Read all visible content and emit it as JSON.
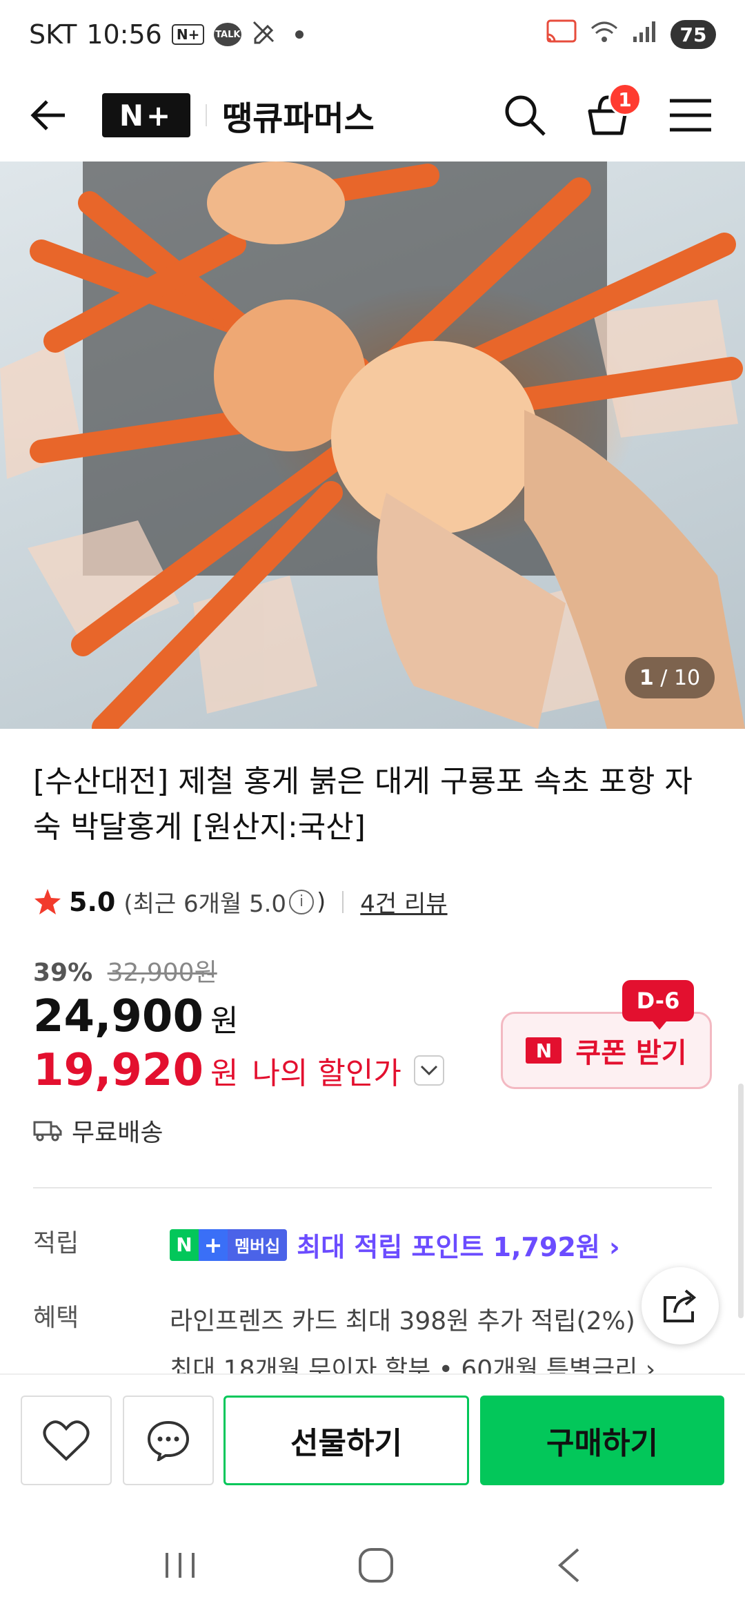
{
  "status_bar": {
    "carrier": "SKT",
    "time": "10:56",
    "np_badge": "N+",
    "talk_badge": "TALK",
    "battery": "75"
  },
  "header": {
    "brand_logo": "N+",
    "store_name": "땡큐파머스",
    "cart_count": "1"
  },
  "gallery": {
    "current": "1",
    "total": "/ 10"
  },
  "product": {
    "title": "[수산대전] 제철 홍게 붉은 대게 구룡포 속초 포항 자숙 박달홍게 [원산지:국산]",
    "rating": "5.0",
    "recent_rating": "(최근 6개월 5.0",
    "recent_close": ")",
    "review_count": "4건 리뷰",
    "discount_rate": "39%",
    "original_price": "32,900원",
    "price": "24,900",
    "price_unit": "원",
    "my_price": "19,920",
    "my_price_unit": "원",
    "my_price_label": "나의 할인가",
    "coupon_label": "쿠폰 받기",
    "coupon_dday": "D-6",
    "shipping": "무료배송"
  },
  "accrue": {
    "label": "적립",
    "badge_text": "멤버십",
    "text": "최대 적립 포인트 1,792원 ›"
  },
  "benefit": {
    "label": "혜택",
    "line1": "라인프렌즈 카드 최대 398원 추가 적립(2%)",
    "line2": "최대 18개월 무이자 할부 • 60개월 특별금리 ›"
  },
  "actions": {
    "gift": "선물하기",
    "buy": "구매하기"
  },
  "colors": {
    "accent_green": "#03c75a",
    "sale_red": "#e3102f",
    "point_purple": "#6b4cff"
  }
}
